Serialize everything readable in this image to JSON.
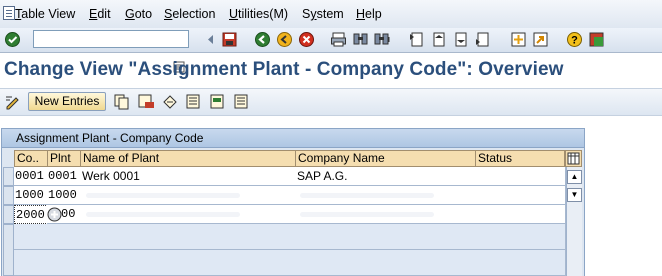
{
  "menu": {
    "items": [
      "Table View",
      "Edit",
      "Goto",
      "Selection",
      "Utilities(M)",
      "System",
      "Help"
    ],
    "underline": [
      "T",
      "E",
      "G",
      "S",
      "U",
      "y",
      "H"
    ]
  },
  "toolbar": {
    "command_field_value": "",
    "icons": [
      "enter-icon",
      "save-icon",
      "back-icon",
      "exit-icon",
      "cancel-icon",
      "print-icon",
      "find-icon",
      "find-next-icon",
      "first-page-icon",
      "previous-page-icon",
      "next-page-icon",
      "last-page-icon",
      "create-session-icon",
      "shortcut-icon",
      "help-icon",
      "layout-icon"
    ]
  },
  "page": {
    "title": "Change View \"Assignment Plant - Company Code\": Overview"
  },
  "app_toolbar": {
    "new_entries_label": "New Entries",
    "icons": [
      "display-change-icon",
      "copy-icon",
      "delete-icon",
      "undo-icon",
      "select-all-icon",
      "select-block-icon",
      "deselect-all-icon"
    ]
  },
  "table": {
    "caption": "Assignment Plant - Company Code",
    "columns": [
      "Co..",
      "Plnt",
      "Name of Plant",
      "Company Name",
      "Status"
    ],
    "rows": [
      {
        "co": "0001",
        "plnt": "0001",
        "name": "Werk 0001",
        "company": "SAP A.G.",
        "status": ""
      },
      {
        "co": "1000",
        "plnt": "1000",
        "name": "",
        "company": "",
        "status": ""
      },
      {
        "co": "2000",
        "plnt": "00",
        "name": "",
        "company": "",
        "status": ""
      }
    ]
  },
  "colors": {
    "title": "#2b4f7c",
    "header": "#f5deb0",
    "caption": "#aec6e3"
  }
}
